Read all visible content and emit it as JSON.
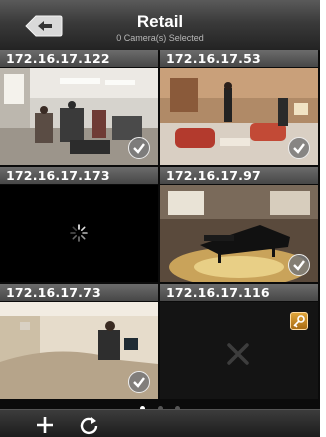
{
  "header": {
    "back_icon": "back-arrow-icon",
    "title": "Retail",
    "subtitle": "0 Camera(s) Selected"
  },
  "cameras": [
    {
      "label": "172.16.17.122",
      "state": "live",
      "selected_icon": "checkmark-icon"
    },
    {
      "label": "172.16.17.53",
      "state": "live",
      "selected_icon": "checkmark-icon"
    },
    {
      "label": "172.16.17.173",
      "state": "loading",
      "status_icon": "loading-spinner-icon"
    },
    {
      "label": "172.16.17.97",
      "state": "live",
      "selected_icon": "checkmark-icon"
    },
    {
      "label": "172.16.17.73",
      "state": "live",
      "selected_icon": "checkmark-icon"
    },
    {
      "label": "172.16.17.116",
      "state": "unavailable",
      "status_icon": "x-icon",
      "lock_icon": "key-icon"
    }
  ],
  "pager": {
    "pages": 3,
    "current": 1
  },
  "toolbar": {
    "add_icon": "plus-icon",
    "refresh_icon": "refresh-icon"
  },
  "colors": {
    "topbar": "#3a3a3a",
    "label_bar": "#575757",
    "lock": "#d18f2a"
  }
}
